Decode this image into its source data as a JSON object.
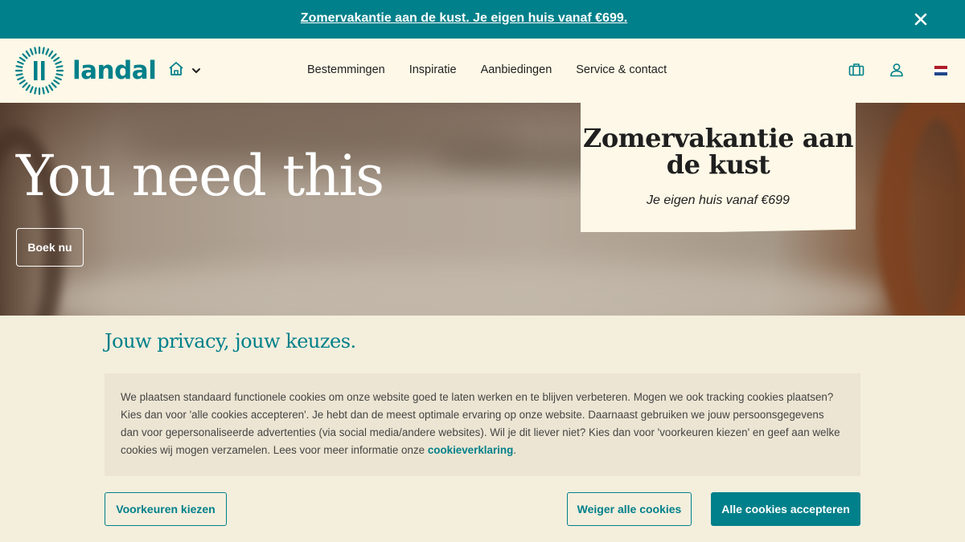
{
  "announcement": {
    "text": "Zomervakantie aan de kust. Je eigen huis vanaf €699.",
    "close_icon": "close-icon"
  },
  "header": {
    "logo_text": "landal",
    "nav": [
      "Bestemmingen",
      "Inspiratie",
      "Aanbiedingen",
      "Service & contact"
    ],
    "icons": [
      "home-icon",
      "chevron-down-icon",
      "suitcase-icon",
      "user-icon",
      "dutch-flag-icon"
    ]
  },
  "hero": {
    "headline": "You need this",
    "cta": "Boek nu"
  },
  "promo": {
    "title": "Zomervakantie aan de kust",
    "subtitle": "Je eigen huis vanaf €699"
  },
  "cookie": {
    "heading": "Jouw privacy, jouw keuzes.",
    "body": "We plaatsen standaard functionele cookies om onze website goed te laten werken en te blijven verbeteren. Mogen we ook tracking cookies plaatsen? Kies dan voor 'alle cookies accepteren'. Je hebt dan de meest optimale ervaring op onze website. Daarnaast gebruiken we jouw persoonsgegevens dan voor gepersonaliseerde advertenties (via social media/andere websites). Wil je dit liever niet? Kies dan voor 'voorkeuren kiezen' en geef aan welke cookies wij mogen verzamelen. Lees voor meer informatie onze ",
    "link": "cookieverklaring",
    "body_end": ".",
    "buttons": {
      "preferences": "Voorkeuren kiezen",
      "reject": "Weiger alle cookies",
      "accept": "Alle cookies accepteren"
    }
  },
  "colors": {
    "brand_teal": "#00808a",
    "cream": "#fdf8e7",
    "banner_bg": "#f4eedd"
  }
}
